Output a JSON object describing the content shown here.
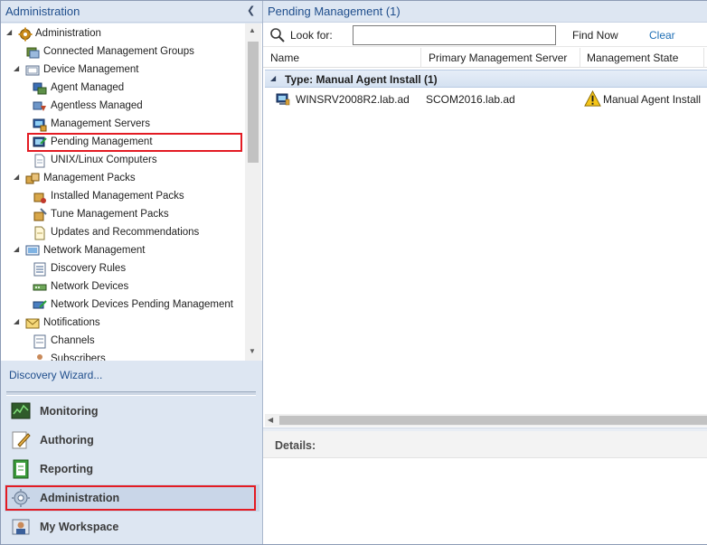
{
  "nav": {
    "title": "Administration",
    "tree": [
      {
        "label": "Administration",
        "icon": "gear-icon"
      },
      {
        "label": "Connected Management Groups",
        "icon": "server-group-icon"
      },
      {
        "label": "Device Management",
        "icon": "folder-icon"
      },
      {
        "label": "Agent Managed",
        "icon": "agent-icon"
      },
      {
        "label": "Agentless Managed",
        "icon": "agentless-icon"
      },
      {
        "label": "Management Servers",
        "icon": "server-icon"
      },
      {
        "label": "Pending Management",
        "icon": "pending-icon",
        "selected": true
      },
      {
        "label": "UNIX/Linux Computers",
        "icon": "document-icon"
      },
      {
        "label": "Management Packs",
        "icon": "packages-icon"
      },
      {
        "label": "Installed Management Packs",
        "icon": "package-icon"
      },
      {
        "label": "Tune Management Packs",
        "icon": "tune-icon"
      },
      {
        "label": "Updates and Recommendations",
        "icon": "document-icon"
      },
      {
        "label": "Network Management",
        "icon": "network-icon"
      },
      {
        "label": "Discovery Rules",
        "icon": "rules-icon"
      },
      {
        "label": "Network Devices",
        "icon": "network-device-icon"
      },
      {
        "label": "Network Devices Pending Management",
        "icon": "network-pending-icon"
      },
      {
        "label": "Notifications",
        "icon": "envelope-icon"
      },
      {
        "label": "Channels",
        "icon": "channels-icon"
      },
      {
        "label": "Subscribers",
        "icon": "subscribers-icon"
      }
    ],
    "discovery_link": "Discovery Wizard...",
    "wunderbar": [
      {
        "label": "Monitoring",
        "icon": "monitoring-icon"
      },
      {
        "label": "Authoring",
        "icon": "authoring-icon"
      },
      {
        "label": "Reporting",
        "icon": "reporting-icon"
      },
      {
        "label": "Administration",
        "icon": "administration-icon",
        "selected": true
      },
      {
        "label": "My Workspace",
        "icon": "workspace-icon"
      }
    ]
  },
  "main": {
    "title": "Pending Management (1)",
    "search": {
      "label": "Look for:",
      "value": "",
      "find_now": "Find Now",
      "clear": "Clear"
    },
    "columns": [
      "Name",
      "Primary Management Server",
      "Management State"
    ],
    "group": "Type: Manual Agent Install (1)",
    "rows": [
      {
        "name": "WINSRV2008R2.lab.ad",
        "server": "SCOM2016.lab.ad",
        "state": "Manual Agent Install"
      }
    ],
    "details_label": "Details:"
  },
  "colors": {
    "accent": "#1f4e8c",
    "highlight": "#e31b23",
    "nav_bg": "#dde6f2"
  }
}
